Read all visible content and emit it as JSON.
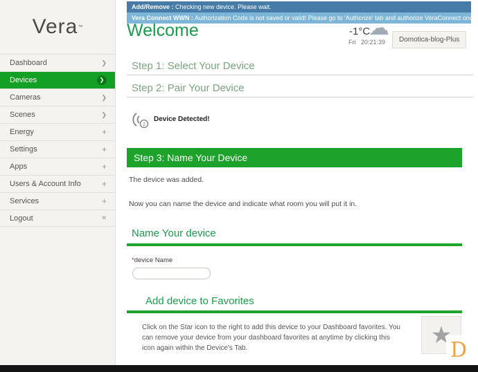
{
  "colors": {
    "accent_green": "#1da32c",
    "heading_green": "#1b9b4d",
    "muted_step_green": "#7aa57f",
    "banner_dark_blue": "#477ca8",
    "banner_light_blue": "#7db5d8",
    "overlay_orange": "#f0a33c"
  },
  "icons": {
    "chevron": "❯",
    "plus": "+",
    "close": "✕",
    "cloud": "☁",
    "star": "★",
    "zwave_letter": "z",
    "required_asterisk": "*"
  },
  "banner": {
    "line1_label": "Add/Remove :",
    "line1_text": " Checking new device. Please wait.",
    "line2_label": "Vera Connect WWN :",
    "line2_text": " Authorization Code is not saved or valid! Please go to 'Authorize' tab and authorize VeraConnect once again!"
  },
  "sidebar": {
    "logo_text": "Vera",
    "logo_tm": "™",
    "items": [
      {
        "label": "Dashboard"
      },
      {
        "label": "Devices"
      },
      {
        "label": "Cameras"
      },
      {
        "label": "Scenes"
      },
      {
        "label": "Energy"
      },
      {
        "label": "Settings"
      },
      {
        "label": "Apps"
      },
      {
        "label": "Users & Account Info"
      },
      {
        "label": "Services"
      },
      {
        "label": "Logout"
      }
    ]
  },
  "header": {
    "title": "Welcome",
    "temperature": "-1°C",
    "day": "Fri",
    "time": "20:21:39",
    "unit_name": "Domotica-blog-Plus"
  },
  "steps": {
    "step1": "Step 1: Select Your Device",
    "step2": "Step 2: Pair Your Device",
    "device_detected": "Device Detected!",
    "step3": "Step 3: Name Your Device",
    "added_text": "The device was added.",
    "room_text": "Now you can name the device and indicate what room you will put it in."
  },
  "name_section": {
    "heading": "Name Your device",
    "label": "device Name",
    "input_value": ""
  },
  "favorites": {
    "heading": "Add device to Favorites",
    "text": "Click on the Star icon to the right to add this device to your Dashboard favorites. You can remove your device from your dashboard favorites at anytime by clicking this icon again within the Device's Tab."
  },
  "overlay": {
    "letter": "D"
  }
}
